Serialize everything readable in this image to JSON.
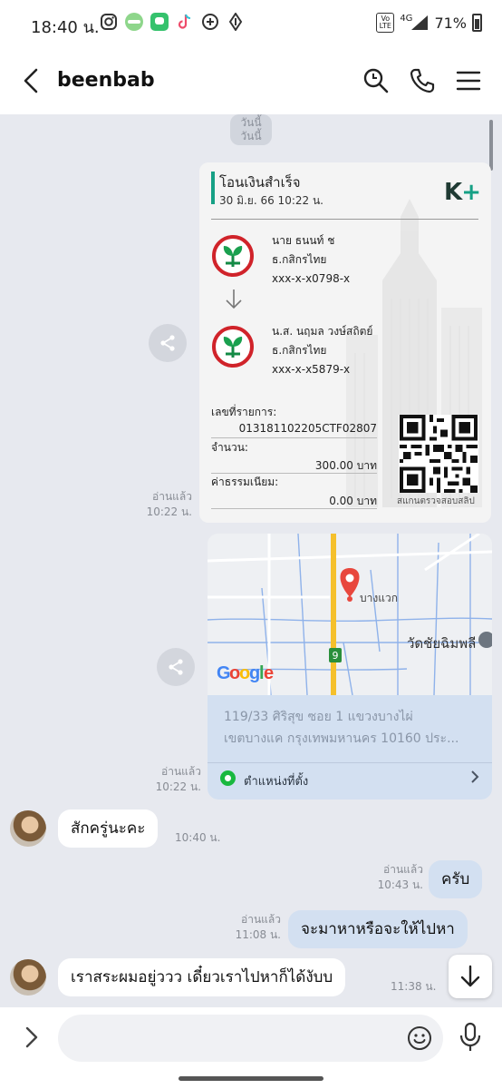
{
  "status_bar": {
    "time": "18:40 น.",
    "network": "4G",
    "volte": "Vo LTE",
    "battery": "71%",
    "app_icons": [
      "instagram-icon",
      "line-icon",
      "line-chat-icon",
      "tiktok-icon",
      "app-icon",
      "wallet-icon"
    ]
  },
  "header": {
    "title": "beenbab",
    "icons": [
      "back-arrow-icon",
      "search-icon",
      "phone-icon",
      "menu-icon"
    ]
  },
  "chat": {
    "date_chip": [
      "วันนี้",
      "วันนี้"
    ],
    "slip": {
      "title": "โอนเงินสำเร็จ",
      "datetime": "30 มิ.ย. 66  10:22 น.",
      "brand_k": "K",
      "brand_plus": "+",
      "sender": {
        "name": "นาย ธนนท์ ช",
        "bank": "ธ.กสิกรไทย",
        "account": "xxx-x-x0798-x"
      },
      "receiver": {
        "name": "น.ส. นฤมล วงษ์สถิตย์",
        "bank": "ธ.กสิกรไทย",
        "account": "xxx-x-x5879-x"
      },
      "ref_label": "เลขที่รายการ:",
      "ref_value": "013181102205CTF02807",
      "amount_label": "จำนวน:",
      "amount_value": "300.00 บาท",
      "fee_label": "ค่าธรรมเนียม:",
      "fee_value": "0.00 บาท",
      "qr_caption": "สแกนตรวจสอบสลิป",
      "read": "อ่านแล้ว",
      "time": "10:22 น."
    },
    "map": {
      "place_label": "บางแวก",
      "temple_label": "วัดชัยฉิมพลี",
      "road_number": "9",
      "google": [
        "G",
        "o",
        "o",
        "g",
        "l",
        "e"
      ],
      "address_line1": "119/33 ศิริสุข ซอย 1 แขวงบางไผ่",
      "address_line2": "เขตบางแค กรุงเทพมหานคร 10160 ประ...",
      "location_link": "ตำแหน่งที่ตั้ง",
      "read": "อ่านแล้ว",
      "time": "10:22 น."
    },
    "messages": [
      {
        "direction": "in",
        "text": "สักครู่นะคะ",
        "time": "10:40 น."
      },
      {
        "direction": "out",
        "text": "ครับ",
        "read": "อ่านแล้ว",
        "time": "10:43 น."
      },
      {
        "direction": "out",
        "text": "จะมาหาหรือจะให้ไปหา",
        "read": "อ่านแล้ว",
        "time": "11:08 น."
      },
      {
        "direction": "in",
        "text": "เราสระผมอยู่ววว เดี๋ยวเราไปหาก็ได้งับบ",
        "time": "11:38 น."
      }
    ]
  },
  "input_bar": {
    "placeholder": "",
    "icons": [
      "chevron-right-icon",
      "emoji-icon",
      "microphone-icon"
    ]
  },
  "colors": {
    "chat_bg": "#e7e9ef",
    "outgoing_bubble": "#d3e0f1",
    "incoming_bubble": "#ffffff",
    "kbank_green": "#16a085",
    "kbank_red": "#d0232a",
    "map_pin": "#e8473d"
  }
}
